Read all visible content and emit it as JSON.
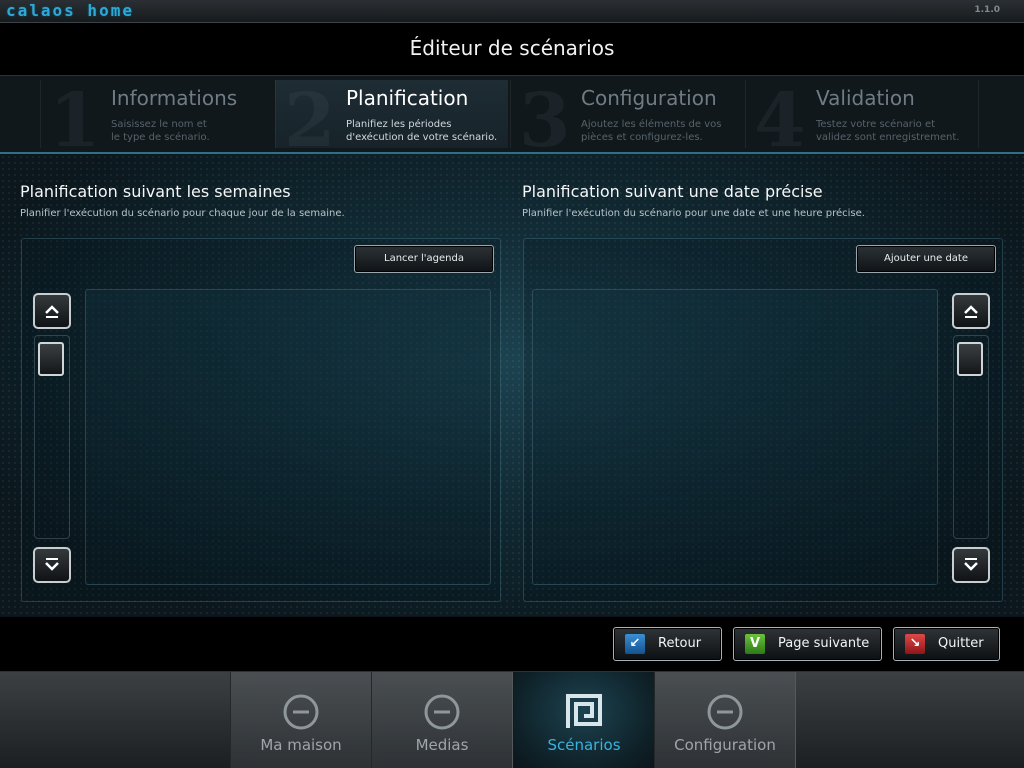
{
  "app": {
    "logo": "calaos home",
    "version": "1.1.0"
  },
  "header": {
    "title": "Éditeur de scénarios"
  },
  "steps": [
    {
      "number": "1",
      "title": "Informations",
      "desc1": "Saisissez le nom et",
      "desc2": "le type de scénario."
    },
    {
      "number": "2",
      "title": "Planification",
      "desc1": "Planifiez les périodes",
      "desc2": "d'exécution de votre scénario.",
      "active": true
    },
    {
      "number": "3",
      "title": "Configuration",
      "desc1": "Ajoutez les éléments de vos",
      "desc2": "pièces et configurez-les."
    },
    {
      "number": "4",
      "title": "Validation",
      "desc1": "Testez votre scénario et",
      "desc2": "validez sont enregistrement."
    }
  ],
  "weekly": {
    "title": "Planification suivant les semaines",
    "subtitle": "Planifier l'exécution du scénario pour chaque jour de la semaine.",
    "button": "Lancer l'agenda"
  },
  "date": {
    "title": "Planification suivant une date précise",
    "subtitle": "Planifier l'exécution du scénario pour une date et une heure précise.",
    "button": "Ajouter une date"
  },
  "actions": {
    "back": "Retour",
    "next": "Page suivante",
    "quit": "Quitter"
  },
  "nav": [
    {
      "label": "Ma maison",
      "icon": "minus-circle-icon"
    },
    {
      "label": "Medias",
      "icon": "minus-circle-icon"
    },
    {
      "label": "Scénarios",
      "icon": "scenario-spiral-icon",
      "active": true
    },
    {
      "label": "Configuration",
      "icon": "minus-circle-icon"
    }
  ],
  "colors": {
    "accent": "#37b3e0",
    "back": "#1f6fb3",
    "next": "#3f9b2a",
    "quit": "#c0282c"
  }
}
